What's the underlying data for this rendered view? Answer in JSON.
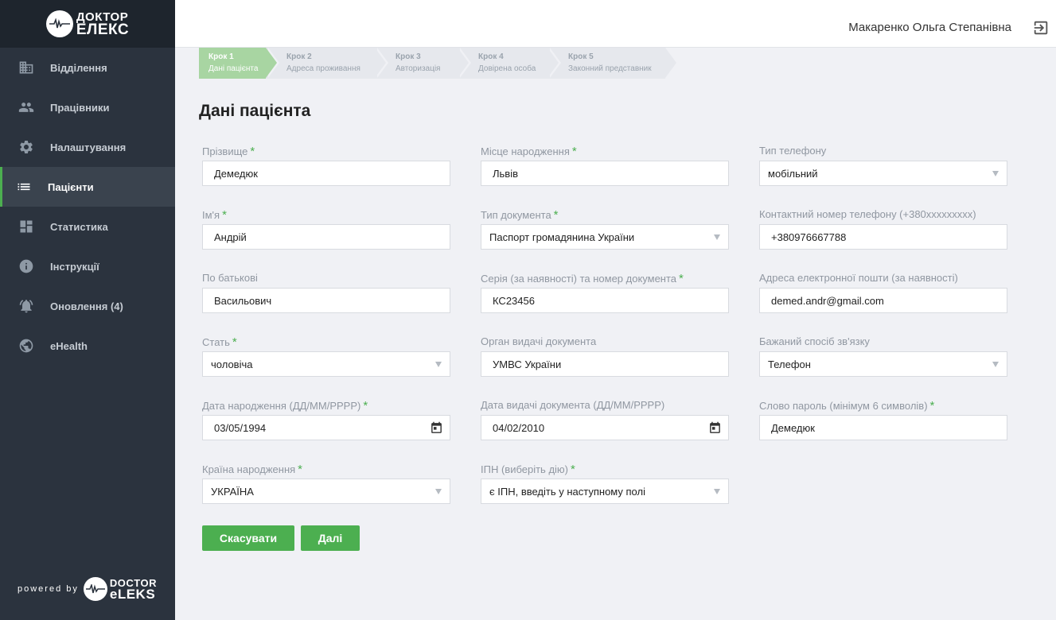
{
  "brand": {
    "line1": "ДОКТОР",
    "line2": "ЕЛЕКС",
    "powered_by": "powered by",
    "powered_line1": "DOCTOR",
    "powered_line2": "eLEKS"
  },
  "header": {
    "user_name": "Макаренко Ольга Степанівна"
  },
  "sidebar": {
    "items": [
      {
        "label": "Відділення",
        "icon": "building-icon"
      },
      {
        "label": "Працівники",
        "icon": "people-icon"
      },
      {
        "label": "Налаштування",
        "icon": "gear-icon"
      },
      {
        "label": "Пацієнти",
        "icon": "list-icon",
        "active": true
      },
      {
        "label": "Статистика",
        "icon": "dashboard-icon"
      },
      {
        "label": "Інструкції",
        "icon": "info-icon"
      },
      {
        "label": "Оновлення (4)",
        "icon": "bell-icon"
      },
      {
        "label": "eHealth",
        "icon": "globe-icon"
      }
    ]
  },
  "steps": [
    {
      "num": "Крок 1",
      "label": "Дані пацієнта",
      "active": true
    },
    {
      "num": "Крок 2",
      "label": "Адреса проживання"
    },
    {
      "num": "Крок 3",
      "label": "Авторизація"
    },
    {
      "num": "Крок 4",
      "label": "Довірена особа"
    },
    {
      "num": "Крок 5",
      "label": "Законний представник"
    }
  ],
  "page_title": "Дані пацієнта",
  "form": {
    "surname": {
      "label": "Прізвище",
      "value": "Демедюк"
    },
    "name": {
      "label": "Ім'я",
      "value": "Андрій"
    },
    "patronymic": {
      "label": "По батькові",
      "value": "Васильович"
    },
    "sex": {
      "label": "Стать",
      "value": "чоловіча"
    },
    "birth_date": {
      "label": "Дата народження (ДД/ММ/РРРР)",
      "value": "03/05/1994"
    },
    "birth_country": {
      "label": "Країна народження",
      "value": "УКРАЇНА"
    },
    "birth_place": {
      "label": "Місце народження",
      "value": "Львів"
    },
    "doc_type": {
      "label": "Тип документа",
      "value": "Паспорт громадянина України"
    },
    "doc_number": {
      "label": "Серія (за наявності) та номер документа",
      "value": "КС23456"
    },
    "doc_issuer": {
      "label": "Орган видачі документа",
      "value": "УМВС України"
    },
    "doc_date": {
      "label": "Дата видачі документа (ДД/ММ/РРРР)",
      "value": "04/02/2010"
    },
    "ipn": {
      "label": "ІПН (виберіть дію)",
      "value": "є ІПН, введіть у наступному полі"
    },
    "phone_type": {
      "label": "Тип телефону",
      "value": "мобільний"
    },
    "phone": {
      "label": "Контактний номер телефону (+380xxxxxxxxx)",
      "value": "+380976667788"
    },
    "email": {
      "label": "Адреса електронної пошти (за наявності)",
      "value": "demed.andr@gmail.com"
    },
    "contact_method": {
      "label": "Бажаний спосіб зв'язку",
      "value": "Телефон"
    },
    "password_word": {
      "label": "Слово пароль (мінімум 6 символів)",
      "value": "Демедюк"
    }
  },
  "buttons": {
    "cancel": "Скасувати",
    "next": "Далі"
  },
  "colors": {
    "accent": "#4caf50",
    "sidebar": "#2b333e"
  }
}
